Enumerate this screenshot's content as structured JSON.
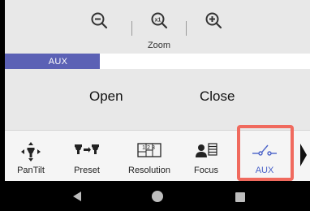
{
  "zoom": {
    "label": "Zoom",
    "buttons": [
      {
        "name": "zoom-out",
        "icon": "magnifier-minus-icon"
      },
      {
        "name": "zoom-reset",
        "icon": "magnifier-x1-icon",
        "glyph": "x1"
      },
      {
        "name": "zoom-in",
        "icon": "magnifier-plus-icon"
      }
    ]
  },
  "aux_bar": {
    "label": "AUX",
    "accent": "#5b61b5"
  },
  "controls": {
    "open_label": "Open",
    "close_label": "Close"
  },
  "toolbar": {
    "items": [
      {
        "label": "PanTilt",
        "icon": "pan-tilt-icon"
      },
      {
        "label": "Preset",
        "icon": "preset-icon"
      },
      {
        "label": "Resolution",
        "icon": "resolution-icon",
        "glyph": "123"
      },
      {
        "label": "Focus",
        "icon": "focus-icon"
      },
      {
        "label": "AUX",
        "icon": "switch-icon",
        "selected": true
      }
    ],
    "selected_color": "#4a62c8",
    "highlight_color": "#f06a5e",
    "more_icon": "chevron-right-icon"
  },
  "navbar": {
    "icons": [
      "back-icon",
      "home-icon",
      "recents-icon"
    ]
  }
}
